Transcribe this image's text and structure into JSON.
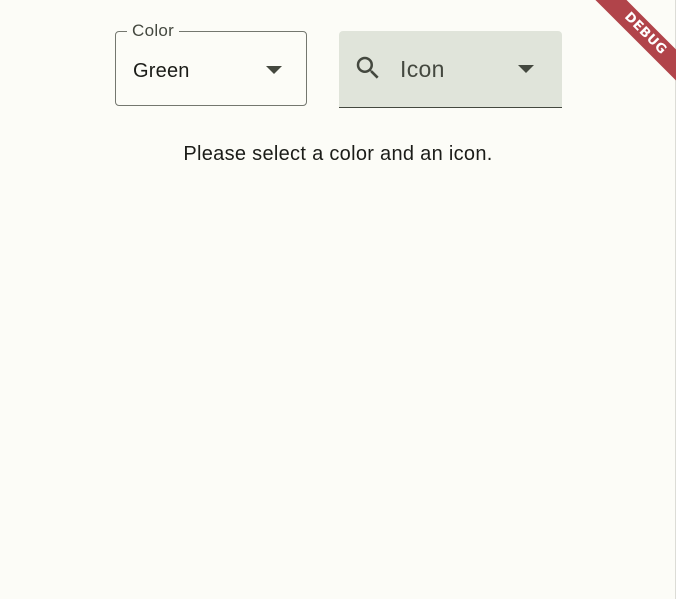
{
  "color_dropdown": {
    "label": "Color",
    "value": "Green",
    "icon": "arrow-drop-down-icon"
  },
  "icon_dropdown": {
    "leading_icon": "search-icon",
    "value": "Icon",
    "icon": "arrow-drop-down-icon"
  },
  "message": "Please select a color and an icon.",
  "debug_banner": "DEBUG",
  "colors": {
    "background": "#fcfcf7",
    "filled_field": "#e0e4da",
    "outline": "#74776f",
    "debug_ribbon": "#b1444a"
  }
}
